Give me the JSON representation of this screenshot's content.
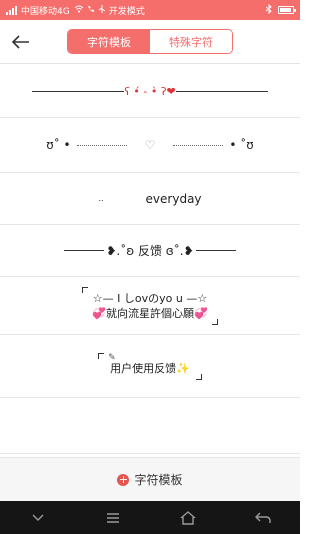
{
  "status": {
    "carrier": "中国移动4G",
    "mode": "开发模式"
  },
  "header": {
    "tabs": [
      {
        "label": "字符模板",
        "active": true
      },
      {
        "label": "特殊字符",
        "active": false
      }
    ]
  },
  "templates": [
    {
      "text": "ʕ •́ - •̀ ʔ❤"
    },
    {
      "left": "ʊ˚ •",
      "heart": "♡",
      "right": "• ˚ʊ"
    },
    {
      "prefix": "..",
      "word": "everyday"
    },
    {
      "text": "❥.˚ʚ 反馈 ɞ˚.❥"
    },
    {
      "line1": "☆— I しovのyo u —☆",
      "line2": "💞就向流星許個心願💞"
    },
    {
      "text": "用户使用反馈✨",
      "mark": "✎"
    }
  ],
  "footer": {
    "add_label": "字符模板",
    "plus": "+"
  },
  "colors": {
    "accent": "#f46e6b",
    "statusbar": "#f56e6b"
  }
}
